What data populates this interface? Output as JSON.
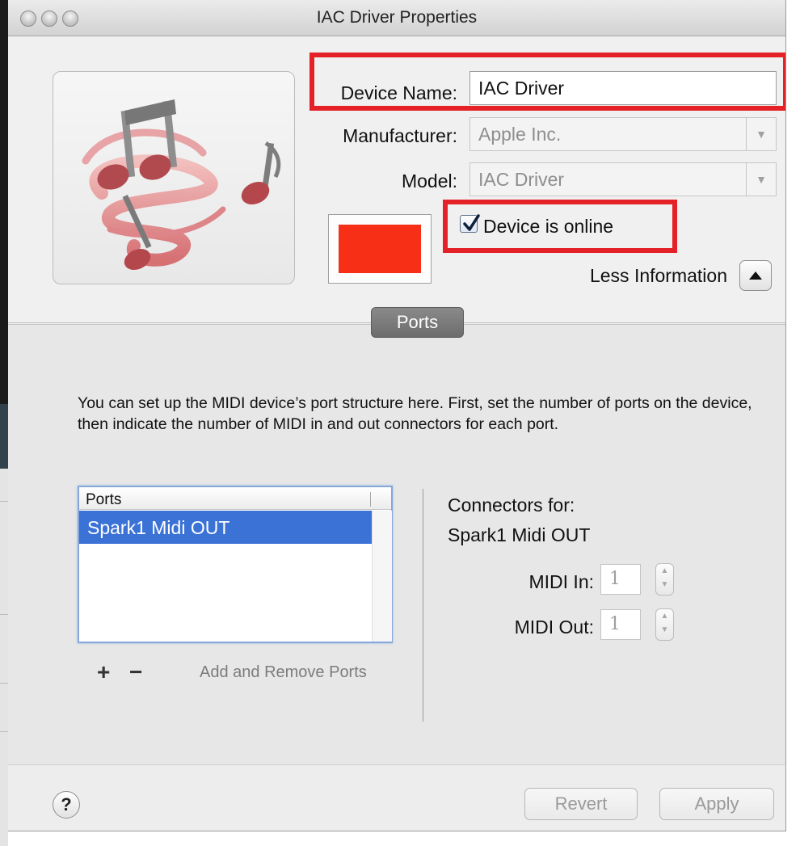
{
  "window": {
    "title": "IAC Driver Properties"
  },
  "device": {
    "name_label": "Device Name:",
    "name_value": "IAC Driver",
    "manufacturer_label": "Manufacturer:",
    "manufacturer_value": "Apple Inc.",
    "model_label": "Model:",
    "model_value": "IAC Driver",
    "online_label": "Device is online",
    "online_checked": true,
    "color_swatch": "#f62f16",
    "less_info_label": "Less Information"
  },
  "ports_section": {
    "tab_label": "Ports",
    "description": "You can set up the MIDI device’s port structure here.  First, set the number of ports on the device, then indicate the number of MIDI in and out connectors for each port.",
    "list_header": "Ports",
    "ports": [
      "Spark1 Midi OUT"
    ],
    "add_icon": "+",
    "remove_icon": "−",
    "add_remove_label": "Add and Remove Ports"
  },
  "connectors": {
    "heading": "Connectors for:",
    "port_name": "Spark1 Midi OUT",
    "midi_in_label": "MIDI In:",
    "midi_in_value": "1",
    "midi_out_label": "MIDI Out:",
    "midi_out_value": "1"
  },
  "footer": {
    "help_label": "?",
    "revert_label": "Revert",
    "apply_label": "Apply"
  },
  "colors": {
    "highlight_box": "#e42127",
    "selection": "#3b72d6"
  }
}
